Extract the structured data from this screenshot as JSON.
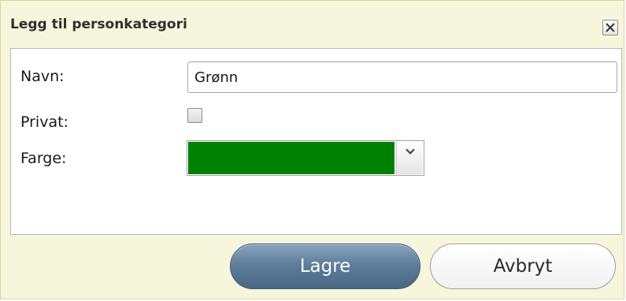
{
  "dialog": {
    "title": "Legg til personkategori",
    "close_icon": "close-icon"
  },
  "form": {
    "name_label": "Navn:",
    "name_value": "Grønn",
    "private_label": "Privat:",
    "private_checked": false,
    "color_label": "Farge:",
    "color_value": "#008000",
    "dropdown_icon": "chevron-down-icon"
  },
  "buttons": {
    "save_label": "Lagre",
    "cancel_label": "Avbryt"
  }
}
